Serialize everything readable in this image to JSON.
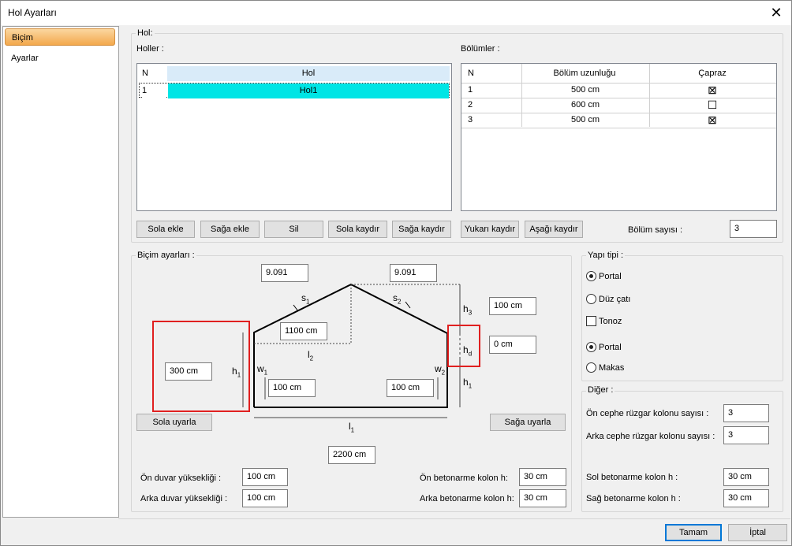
{
  "window": {
    "title": "Hol Ayarları",
    "close_glyph": "✕"
  },
  "nav": {
    "items": [
      "Biçim",
      "Ayarlar"
    ]
  },
  "hol_group": {
    "label": "Hol:",
    "holler_label": "Holler :",
    "bolumler_label": "Bölümler :",
    "holler_table": {
      "headers": [
        "N",
        "Hol"
      ],
      "rows": [
        [
          "1",
          "Hol1"
        ]
      ]
    },
    "bolumler_table": {
      "headers": [
        "N",
        "Bölüm uzunluğu",
        "Çapraz"
      ],
      "rows": [
        {
          "n": "1",
          "len": "500 cm",
          "capraz": "⊠"
        },
        {
          "n": "2",
          "len": "600 cm",
          "capraz": "☐"
        },
        {
          "n": "3",
          "len": "500 cm",
          "capraz": "⊠"
        }
      ]
    },
    "buttons": [
      "Sola ekle",
      "Sağa ekle",
      "Sil",
      "Sola kaydır",
      "Sağa kaydır",
      "Yukarı kaydır",
      "Aşağı kaydır"
    ],
    "bolum_sayisi_label": "Bölüm sayısı :",
    "bolum_sayisi": "3"
  },
  "bicim": {
    "label": "Biçim ayarları :",
    "slope_left": "9.091",
    "slope_right": "9.091",
    "h3": "100 cm",
    "hd": "0 cm",
    "l2": "1100 cm",
    "h1_left": "300 cm",
    "w1": "100 cm",
    "w2": "100 cm",
    "l1": "2200 cm",
    "sola_uyarla": "Sola uyarla",
    "saga_uyarla": "Sağa uyarla",
    "dim_labels": {
      "s1": "s",
      "s1_sub": "1",
      "s2": "s",
      "s2_sub": "2",
      "h3": "h",
      "h3_sub": "3",
      "hd": "h",
      "hd_sub": "d",
      "h1": "h",
      "h1_sub": "1",
      "w1": "w",
      "w1_sub": "1",
      "w2": "w",
      "w2_sub": "2",
      "l2": "l",
      "l2_sub": "2",
      "l1": "l",
      "l1_sub": "1"
    },
    "on_duvar_label": "Ön duvar yüksekliği :",
    "on_duvar": "100 cm",
    "arka_duvar_label": "Arka duvar yüksekliği :",
    "arka_duvar": "100 cm",
    "on_beton_label": "Ön betonarme kolon h:",
    "on_beton": "30 cm",
    "arka_beton_label": "Arka betonarme kolon h:",
    "arka_beton": "30 cm"
  },
  "yapi": {
    "label": "Yapı tipi :",
    "portal1": "Portal",
    "duz_cati": "Düz çatı",
    "tonoz": "Tonoz",
    "portal2": "Portal",
    "makas": "Makas"
  },
  "diger": {
    "label": "Diğer :",
    "on_ruzgar_label": "Ön cephe rüzgar kolonu sayısı :",
    "on_ruzgar": "3",
    "arka_ruzgar_label": "Arka cephe rüzgar kolonu sayısı :",
    "arka_ruzgar": "3",
    "sol_beton_label": "Sol betonarme kolon h :",
    "sol_beton": "30 cm",
    "sag_beton_label": "Sağ betonarme kolon h :",
    "sag_beton": "30 cm"
  },
  "footer": {
    "ok": "Tamam",
    "cancel": "İptal"
  }
}
